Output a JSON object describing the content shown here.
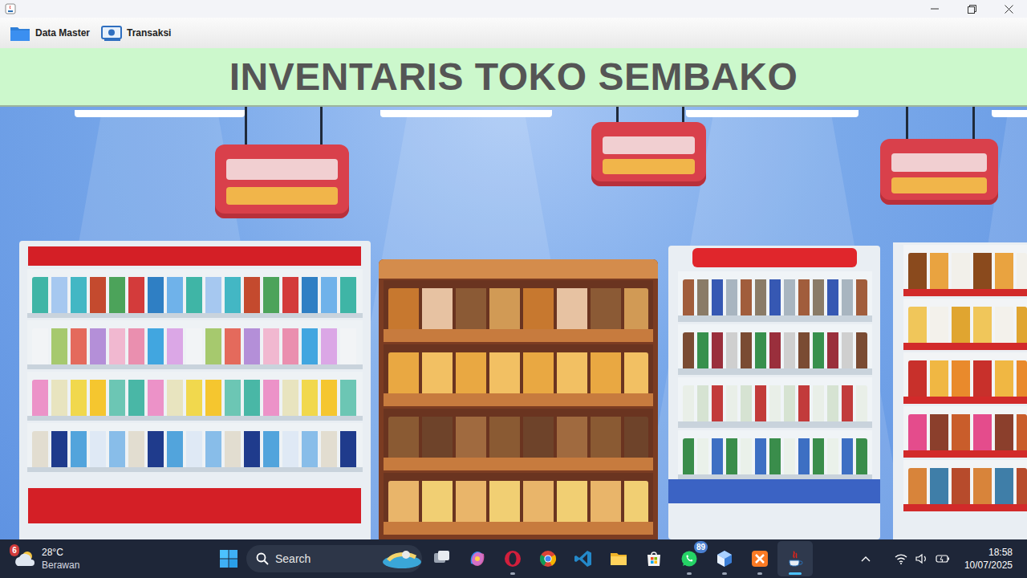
{
  "menu": [
    {
      "label": "Data Master"
    },
    {
      "label": "Transaksi"
    }
  ],
  "banner": {
    "title": "INVENTARIS TOKO SEMBAKO"
  },
  "taskbar": {
    "weather": {
      "badge": "6",
      "temperature": "28°C",
      "condition": "Berawan"
    },
    "search": {
      "placeholder": "Search"
    },
    "apps": [
      {
        "kind": "taskview",
        "running": false,
        "active": false
      },
      {
        "kind": "copilot",
        "running": false,
        "active": false
      },
      {
        "kind": "opera",
        "running": true,
        "active": false
      },
      {
        "kind": "chrome",
        "running": false,
        "active": false
      },
      {
        "kind": "vscode",
        "running": false,
        "active": false
      },
      {
        "kind": "explorer",
        "running": false,
        "active": false
      },
      {
        "kind": "store",
        "running": false,
        "active": false
      },
      {
        "kind": "whatsapp",
        "running": true,
        "active": false,
        "badge": "89"
      },
      {
        "kind": "cube",
        "running": true,
        "active": false
      },
      {
        "kind": "xampp",
        "running": true,
        "active": false
      },
      {
        "kind": "java",
        "running": true,
        "active": true
      }
    ],
    "clock": {
      "time": "18:58",
      "date": "10/07/2025"
    }
  }
}
